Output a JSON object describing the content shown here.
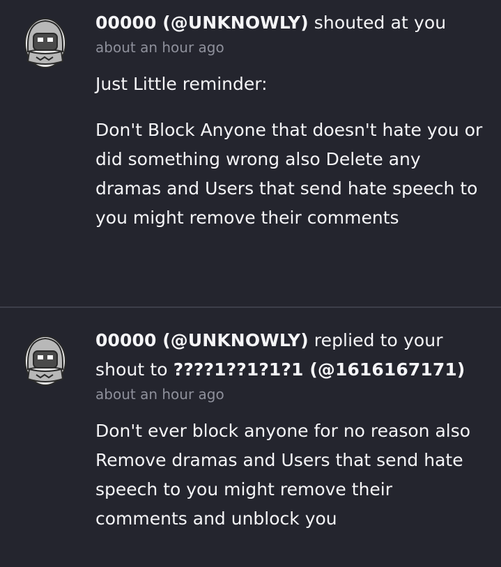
{
  "feed": {
    "items": [
      {
        "author": "00000 (@UNKNOWLY)",
        "action": "shouted at you",
        "target": "",
        "time": "about an hour ago",
        "paragraphs": [
          "Just Little reminder:",
          "Don't Block Anyone that doesn't hate you or did something wrong also Delete any dramas and Users that send hate speech to you might remove their comments"
        ]
      },
      {
        "author": "00000 (@UNKNOWLY)",
        "action": "replied to your shout to",
        "target": "????1??1?1?1 (@1616167171)",
        "time": "about an hour ago",
        "paragraphs": [
          "Don't ever block anyone for no reason also Remove dramas and Users that send hate speech to you might remove their comments and unblock you"
        ]
      }
    ]
  },
  "avatar": {
    "icon": "hooded-figure-avatar",
    "colors": {
      "hood": "#b8b8b8",
      "outline": "#2a2a2a",
      "face": "#4a4a4a",
      "eyes": "#ffffff"
    }
  },
  "colors": {
    "background": "#24252e",
    "text": "#f5f5f7",
    "muted": "#8e909b",
    "divider": "#3d3f4a"
  }
}
